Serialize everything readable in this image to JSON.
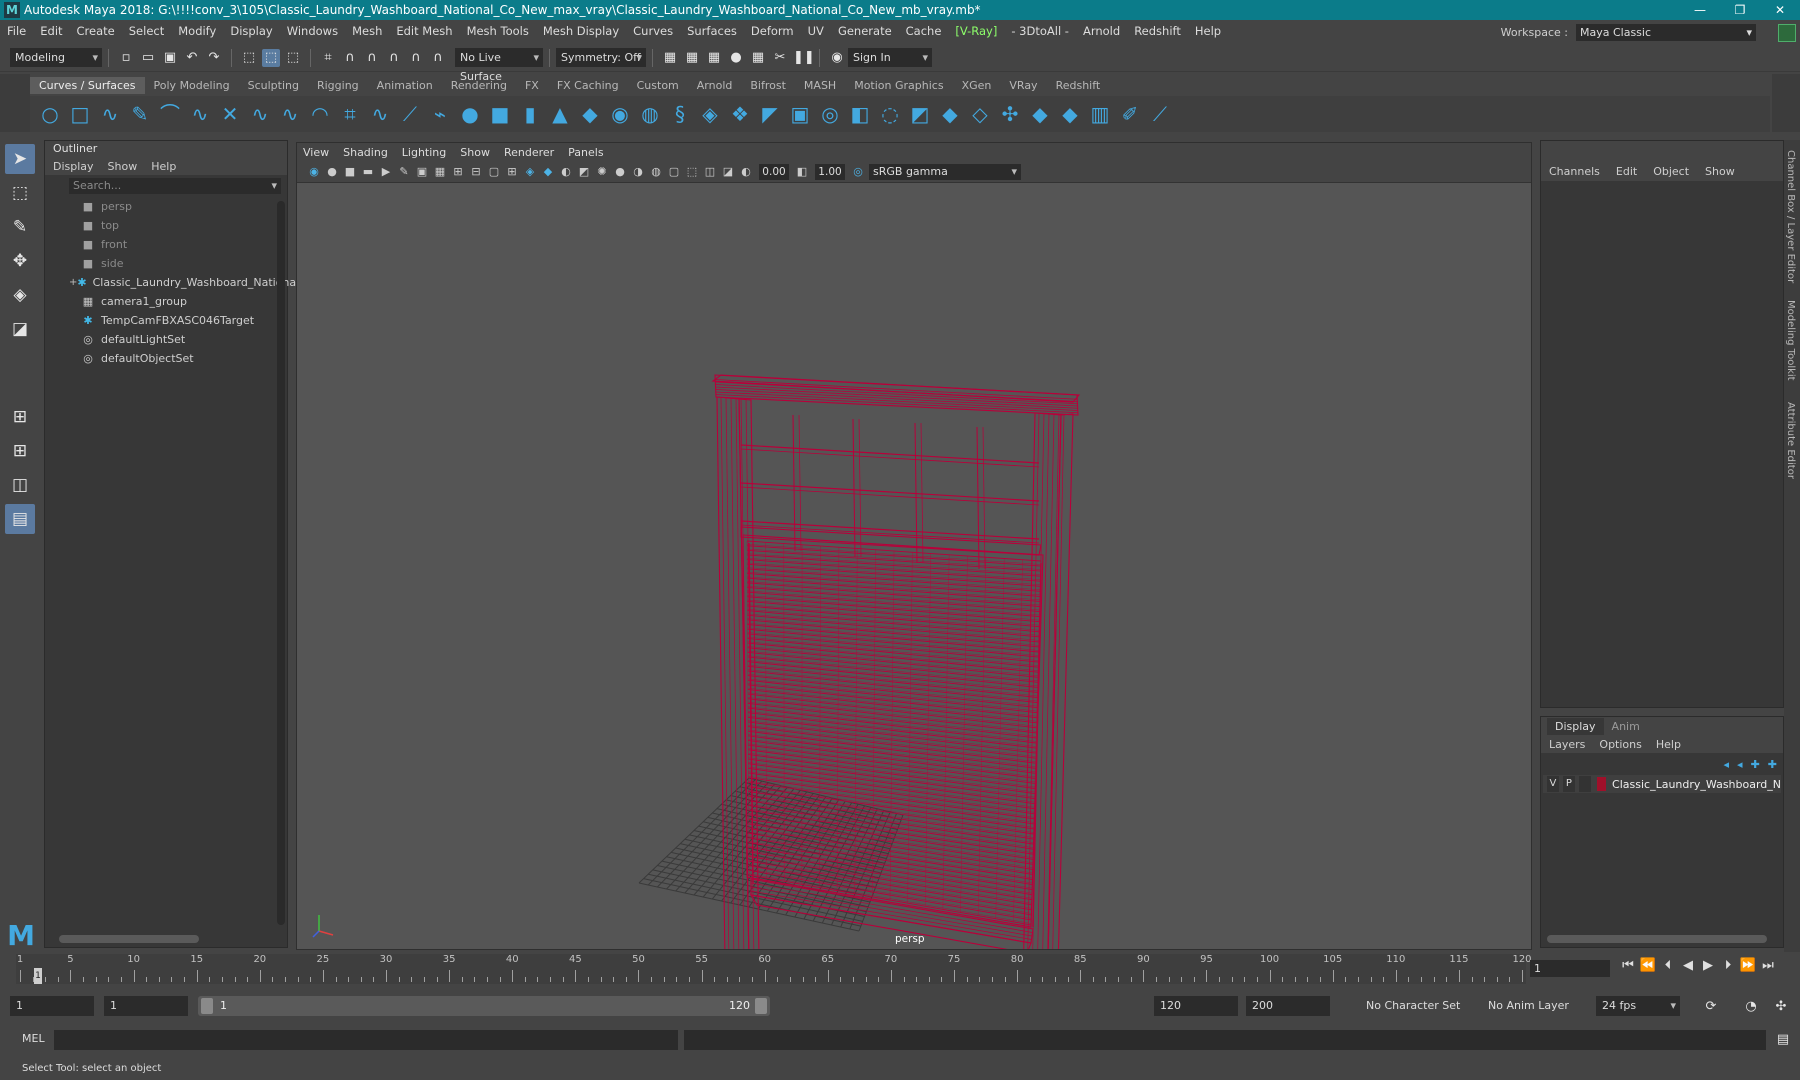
{
  "title": "Autodesk Maya 2018: G:\\!!!!conv_3\\105\\Classic_Laundry_Washboard_National_Co_New_max_vray\\Classic_Laundry_Washboard_National_Co_New_mb_vray.mb*",
  "menu": [
    "File",
    "Edit",
    "Create",
    "Select",
    "Modify",
    "Display",
    "Windows",
    "Mesh",
    "Edit Mesh",
    "Mesh Tools",
    "Mesh Display",
    "Curves",
    "Surfaces",
    "Deform",
    "UV",
    "Generate",
    "Cache",
    "V-Ray",
    "3DtoAll",
    "Arnold",
    "Redshift",
    "Help"
  ],
  "workspace": {
    "label": "Workspace :",
    "value": "Maya Classic"
  },
  "status": {
    "mode": "Modeling",
    "live_surface": "No Live Surface",
    "symmetry": "Symmetry: Off",
    "sign_in": "Sign In"
  },
  "shelf_tabs": [
    "Curves / Surfaces",
    "Poly Modeling",
    "Sculpting",
    "Rigging",
    "Animation",
    "Rendering",
    "FX",
    "FX Caching",
    "Custom",
    "Arnold",
    "Bifrost",
    "MASH",
    "Motion Graphics",
    "XGen",
    "VRay",
    "Redshift"
  ],
  "outliner": {
    "title": "Outliner",
    "menu": [
      "Display",
      "Show",
      "Help"
    ],
    "search_placeholder": "Search...",
    "items": [
      {
        "label": "persp",
        "icon": "camera-icon",
        "dim": true
      },
      {
        "label": "top",
        "icon": "camera-icon",
        "dim": true
      },
      {
        "label": "front",
        "icon": "camera-icon",
        "dim": true
      },
      {
        "label": "side",
        "icon": "camera-icon",
        "dim": true
      },
      {
        "label": "Classic_Laundry_Washboard_Nationa",
        "icon": "transform-icon",
        "expand": "+"
      },
      {
        "label": "camera1_group",
        "icon": "group-icon"
      },
      {
        "label": "TempCamFBXASC046Target",
        "icon": "transform-icon"
      },
      {
        "label": "defaultLightSet",
        "icon": "set-icon"
      },
      {
        "label": "defaultObjectSet",
        "icon": "set-icon"
      }
    ]
  },
  "viewport": {
    "menu": [
      "View",
      "Shading",
      "Lighting",
      "Show",
      "Renderer",
      "Panels"
    ],
    "exposure": "0.00",
    "gamma_value": "1.00",
    "color_space": "sRGB gamma",
    "camera": "persp"
  },
  "channel_box": {
    "menu": [
      "Channels",
      "Edit",
      "Object",
      "Show"
    ]
  },
  "side_tabs": [
    "Channel Box / Layer Editor",
    "Modeling Toolkit",
    "Attribute Editor"
  ],
  "layers": {
    "tabs": [
      "Display",
      "Anim"
    ],
    "menu": [
      "Layers",
      "Options",
      "Help"
    ],
    "row": {
      "v": "V",
      "p": "P",
      "name": "Classic_Laundry_Washboard_N",
      "color": "#a0102a"
    }
  },
  "timeline": {
    "ticks": [
      1,
      5,
      10,
      15,
      20,
      25,
      30,
      35,
      40,
      45,
      50,
      55,
      60,
      65,
      70,
      75,
      80,
      85,
      90,
      95,
      100,
      105,
      110,
      115,
      120
    ],
    "current": "1",
    "frame_field": "1"
  },
  "range": {
    "start": "1",
    "playback_start": "1",
    "slider_start": "1",
    "slider_end": "120",
    "playback_end": "120",
    "end": "200",
    "character_set": "No Character Set",
    "anim_layer": "No Anim Layer",
    "fps": "24 fps"
  },
  "command": {
    "label": "MEL"
  },
  "help_text": "Select Tool: select an object",
  "colors": {
    "wireframe": "#b8003a",
    "accent": "#43a9e0",
    "titlebar": "#0b7c8a"
  }
}
